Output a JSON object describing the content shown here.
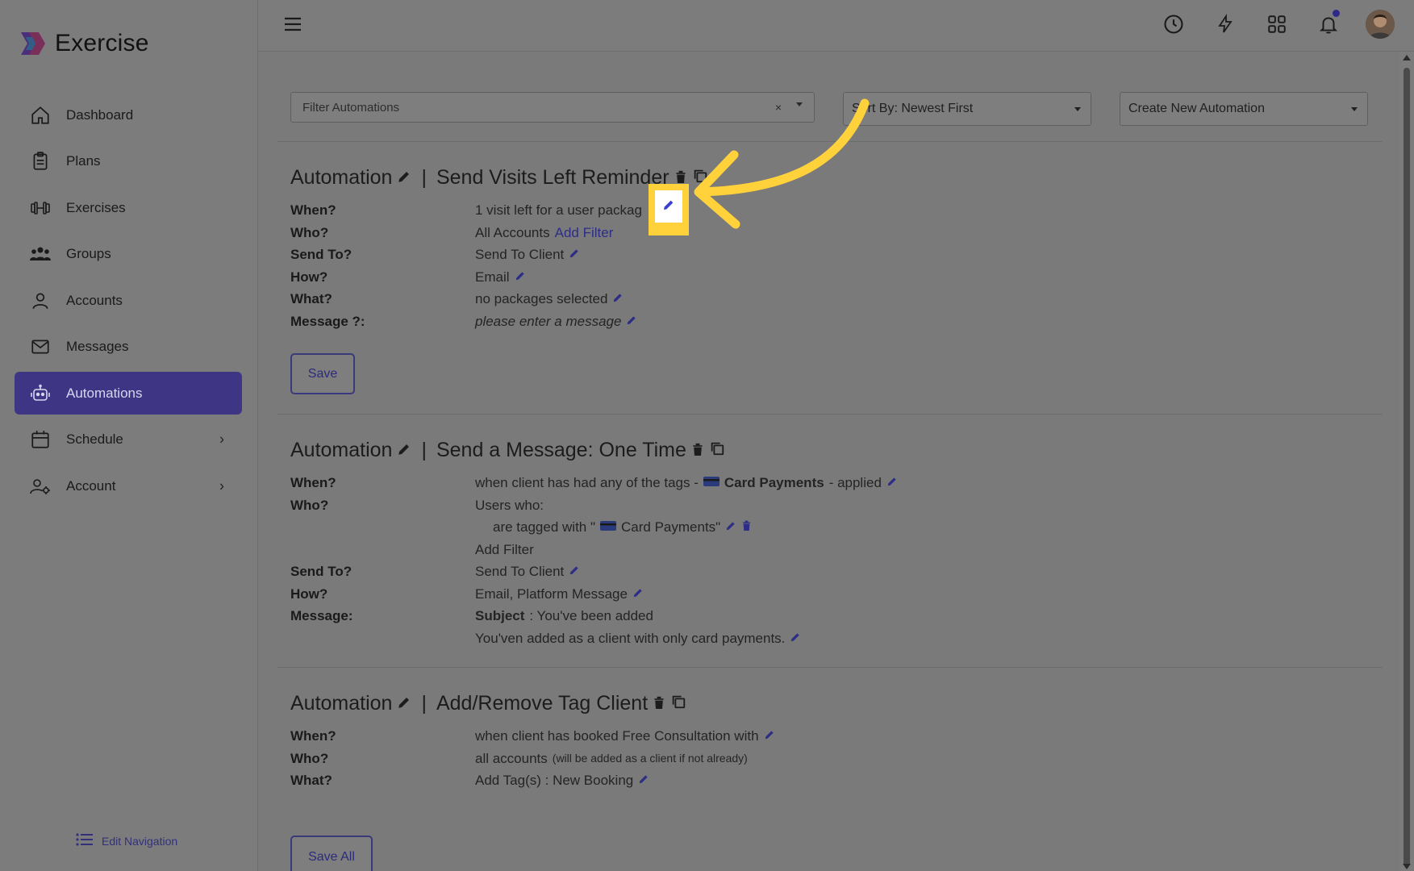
{
  "app": {
    "name": "Exercise"
  },
  "sidebar": {
    "items": [
      {
        "label": "Dashboard",
        "icon": "home-icon",
        "active": false
      },
      {
        "label": "Plans",
        "icon": "clipboard-icon",
        "active": false
      },
      {
        "label": "Exercises",
        "icon": "dumbbell-icon",
        "active": false
      },
      {
        "label": "Groups",
        "icon": "users-icon",
        "active": false
      },
      {
        "label": "Accounts",
        "icon": "user-icon",
        "active": false
      },
      {
        "label": "Messages",
        "icon": "envelope-icon",
        "active": false
      },
      {
        "label": "Automations",
        "icon": "robot-icon",
        "active": true
      },
      {
        "label": "Schedule",
        "icon": "calendar-icon",
        "active": false,
        "has_children": true
      },
      {
        "label": "Account",
        "icon": "user-gear-icon",
        "active": false,
        "has_children": true
      }
    ],
    "edit_navigation": "Edit Navigation"
  },
  "topbar": {
    "icons": [
      "history-icon",
      "bolt-icon",
      "grid-icon",
      "bell-icon",
      "avatar"
    ]
  },
  "filters": {
    "filter_placeholder": "Filter Automations",
    "clear_symbol": "×",
    "sort_label": "Sort By: Newest First",
    "create_label": "Create New Automation"
  },
  "automations": [
    {
      "prefix": "Automation",
      "name": "Send Visits Left Reminder",
      "rows": {
        "when_label": "When?",
        "when_value": "1 visit left for a user packag",
        "who_label": "Who?",
        "who_value": "All Accounts",
        "who_link": "Add Filter",
        "sendto_label": "Send To?",
        "sendto_value": "Send To Client",
        "how_label": "How?",
        "how_value": "Email",
        "what_label": "What?",
        "what_value": "no packages selected",
        "message_label": "Message ?:",
        "message_value": "please enter a message"
      },
      "save_label": "Save"
    },
    {
      "prefix": "Automation",
      "name": "Send a Message: One Time",
      "rows": {
        "when_label": "When?",
        "when_pre": "when client has had any of the tags -",
        "when_tag": "Card Payments",
        "when_post": "- applied",
        "who_label": "Who?",
        "who_value": "Users who:",
        "who_sub_pre": "are tagged with \"",
        "who_sub_tag": "Card Payments\"",
        "who_link": "Add Filter",
        "sendto_label": "Send To?",
        "sendto_value": "Send To Client",
        "how_label": "How?",
        "how_value": "Email, Platform Message",
        "message_label": "Message:",
        "subject_label": "Subject",
        "subject_value": ": You've been added",
        "body_value": "You'ven added as a client with only card payments."
      }
    },
    {
      "prefix": "Automation",
      "name": "Add/Remove Tag Client",
      "rows": {
        "when_label": "When?",
        "when_value": "when client has booked Free Consultation with",
        "who_label": "Who?",
        "who_value": "all accounts",
        "who_small": "(will be added as a client if not already)",
        "what_label": "What?",
        "what_value": "Add Tag(s) : New Booking"
      }
    }
  ],
  "save_all_label": "Save All",
  "colors": {
    "accent": "#3f3585",
    "highlight": "#ffd23c",
    "link": "#2c2d86"
  }
}
